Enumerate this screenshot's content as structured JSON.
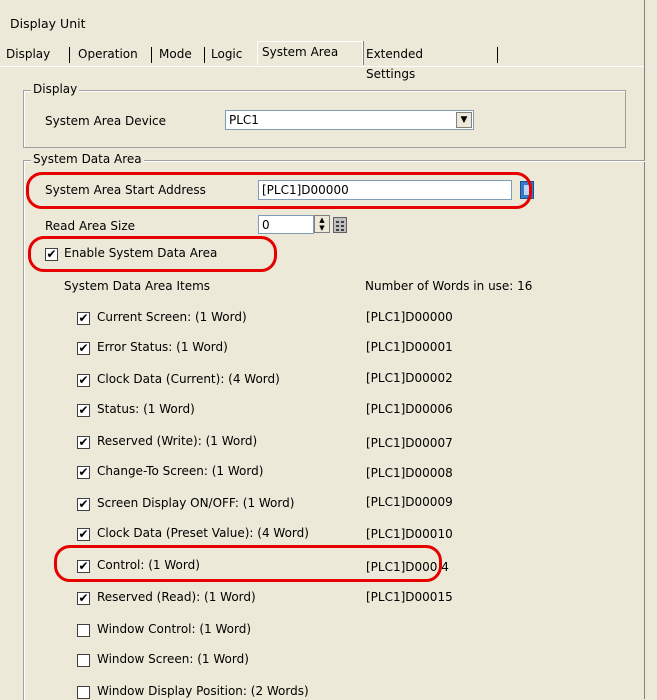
{
  "window": {
    "title": "Display Unit"
  },
  "tabs": [
    {
      "label": "Display"
    },
    {
      "label": "Operation"
    },
    {
      "label": "Mode"
    },
    {
      "label": "Logic"
    },
    {
      "label": "System Area"
    },
    {
      "label": "Extended Settings"
    }
  ],
  "display_group": {
    "legend": "Display",
    "device_label": "System Area Device",
    "device_value": "PLC1"
  },
  "system_data_group": {
    "legend": "System Data Area",
    "start_address_label": "System Area Start Address",
    "start_address_value": "[PLC1]D00000",
    "read_size_label": "Read Area Size",
    "read_size_value": "0",
    "enable_label": "Enable System Data Area",
    "enable_checked": true,
    "items_header": "System Data Area Items",
    "words_in_use": "Number of Words in use: 16",
    "items": [
      {
        "label": "Current Screen: (1 Word)",
        "checked": true,
        "address": "[PLC1]D00000"
      },
      {
        "label": "Error Status: (1 Word)",
        "checked": true,
        "address": "[PLC1]D00001"
      },
      {
        "label": "Clock Data (Current): (4 Word)",
        "checked": true,
        "address": "[PLC1]D00002"
      },
      {
        "label": "Status: (1 Word)",
        "checked": true,
        "address": "[PLC1]D00006"
      },
      {
        "label": "Reserved (Write): (1 Word)",
        "checked": true,
        "address": "[PLC1]D00007"
      },
      {
        "label": "Change-To Screen: (1 Word)",
        "checked": true,
        "address": "[PLC1]D00008"
      },
      {
        "label": "Screen Display ON/OFF: (1 Word)",
        "checked": true,
        "address": "[PLC1]D00009"
      },
      {
        "label": "Clock Data (Preset Value): (4 Word)",
        "checked": true,
        "address": "[PLC1]D00010"
      },
      {
        "label": "Control: (1 Word)",
        "checked": true,
        "address": "[PLC1]D000 4"
      },
      {
        "label": "Reserved (Read): (1 Word)",
        "checked": true,
        "address": "[PLC1]D00015"
      },
      {
        "label": "Window Control: (1 Word)",
        "checked": false,
        "address": ""
      },
      {
        "label": "Window Screen: (1 Word)",
        "checked": false,
        "address": ""
      },
      {
        "label": "Window Display Position: (2 Words)",
        "checked": false,
        "address": ""
      }
    ]
  },
  "glyphs": {
    "check": "✔",
    "dropdown": "▼",
    "spin_up": "▲",
    "spin_down": "▼"
  },
  "colors": {
    "highlight": "#e60000",
    "background": "#ece9d8"
  }
}
